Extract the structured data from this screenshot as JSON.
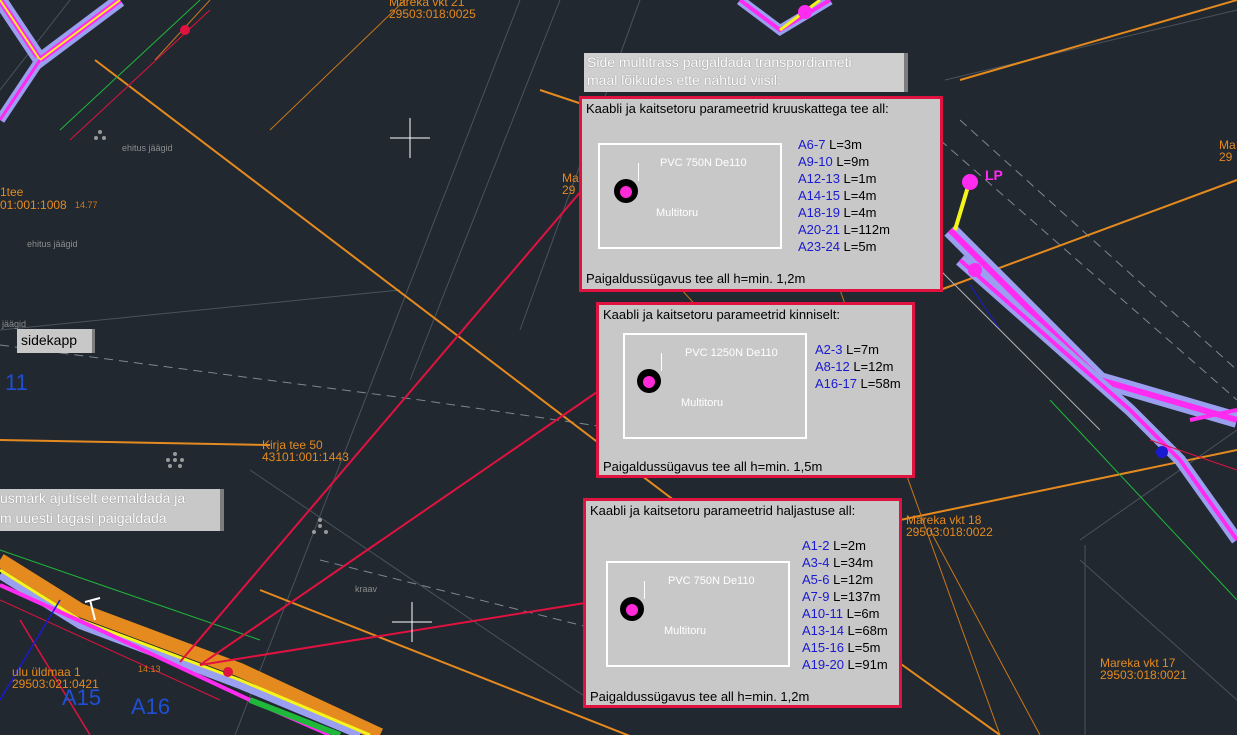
{
  "map_labels": {
    "mareka21_name": "Mareka  vkt  21",
    "mareka21_code": "29503:018:0025",
    "mareka18_name": "Mareka  vkt  18",
    "mareka18_code": "29503:018:0022",
    "mareka17_name": "Mareka  vkt  17",
    "mareka17_code": "29503:018:0021",
    "kirja_name": "Kirja  tee  50",
    "kirja_code": "43101:001:1443",
    "tee_name": "1tee",
    "tee_code": "01:001:1008",
    "tee_elev": "14.77",
    "ulidmaa_name": "ulu  üldmaa  1",
    "ulidmaa_code": "29503:021:0421",
    "elev_1413": "14.13",
    "ehitus1": "ehitus  jäägid",
    "ehitus2": "ehitus  jäägid",
    "jaagid": "jäägid",
    "kraav": "kraav",
    "ma_edge": "Ma",
    "ma_edge2": "29",
    "ma_right": "Ma",
    "ma_right2": "29",
    "a11": "11",
    "a15": "A15",
    "a16": "A16",
    "lp_label": "LP"
  },
  "notes": {
    "sidekapp": "sidekapp",
    "multitrass_line1": "Side multitrass paigaldada transpordiameti",
    "multitrass_line2": "maal lõikudes ette nähtud viisil:",
    "sign_line1": "usmärk ajutiselt eemaldada ja",
    "sign_line2": "m uuesti tagasi paigaldada"
  },
  "details": [
    {
      "title": "Kaabli ja kaitsetoru parameetrid kruuskattega tee all:",
      "pipe_label": "PVC 750N De110",
      "inner_label": "Multitoru",
      "depth": "Paigaldussügavus tee all h=min. 1,2m",
      "rows": [
        {
          "code": "A6-7",
          "len": "L=3m"
        },
        {
          "code": "A9-10",
          "len": "L=9m"
        },
        {
          "code": "A12-13",
          "len": "L=1m"
        },
        {
          "code": "A14-15",
          "len": "L=4m"
        },
        {
          "code": "A18-19",
          "len": "L=4m"
        },
        {
          "code": "A20-21",
          "len": "L=112m"
        },
        {
          "code": "A23-24",
          "len": "L=5m"
        }
      ]
    },
    {
      "title": "Kaabli ja kaitsetoru parameetrid kinniselt:",
      "pipe_label": "PVC 1250N De110",
      "inner_label": "Multitoru",
      "depth": "Paigaldussügavus tee all h=min. 1,5m",
      "rows": [
        {
          "code": "A2-3",
          "len": "L=7m"
        },
        {
          "code": "A8-12",
          "len": "L=12m"
        },
        {
          "code": "A16-17",
          "len": "L=58m"
        }
      ]
    },
    {
      "title": "Kaabli ja kaitsetoru parameetrid haljastuse all:",
      "pipe_label": "PVC 750N De110",
      "inner_label": "Multitoru",
      "depth": "Paigaldussügavus tee all h=min. 1,2m",
      "rows": [
        {
          "code": "A1-2",
          "len": "L=2m"
        },
        {
          "code": "A3-4",
          "len": "L=34m"
        },
        {
          "code": "A5-6",
          "len": "L=12m"
        },
        {
          "code": "A7-9",
          "len": "L=137m"
        },
        {
          "code": "A10-11",
          "len": "L=6m"
        },
        {
          "code": "A13-14",
          "len": "L=68m"
        },
        {
          "code": "A15-16",
          "len": "L=5m"
        },
        {
          "code": "A19-20",
          "len": "L=91m"
        }
      ]
    }
  ],
  "colors": {
    "background": "#212830",
    "plot_orange": "#e58a1f",
    "callout_red": "#e0123f",
    "route_magenta": "#ff2bf0",
    "route_yellow": "#f5f51c",
    "route_blue": "#8a8cf0",
    "code_blue": "#1a1ad0"
  }
}
